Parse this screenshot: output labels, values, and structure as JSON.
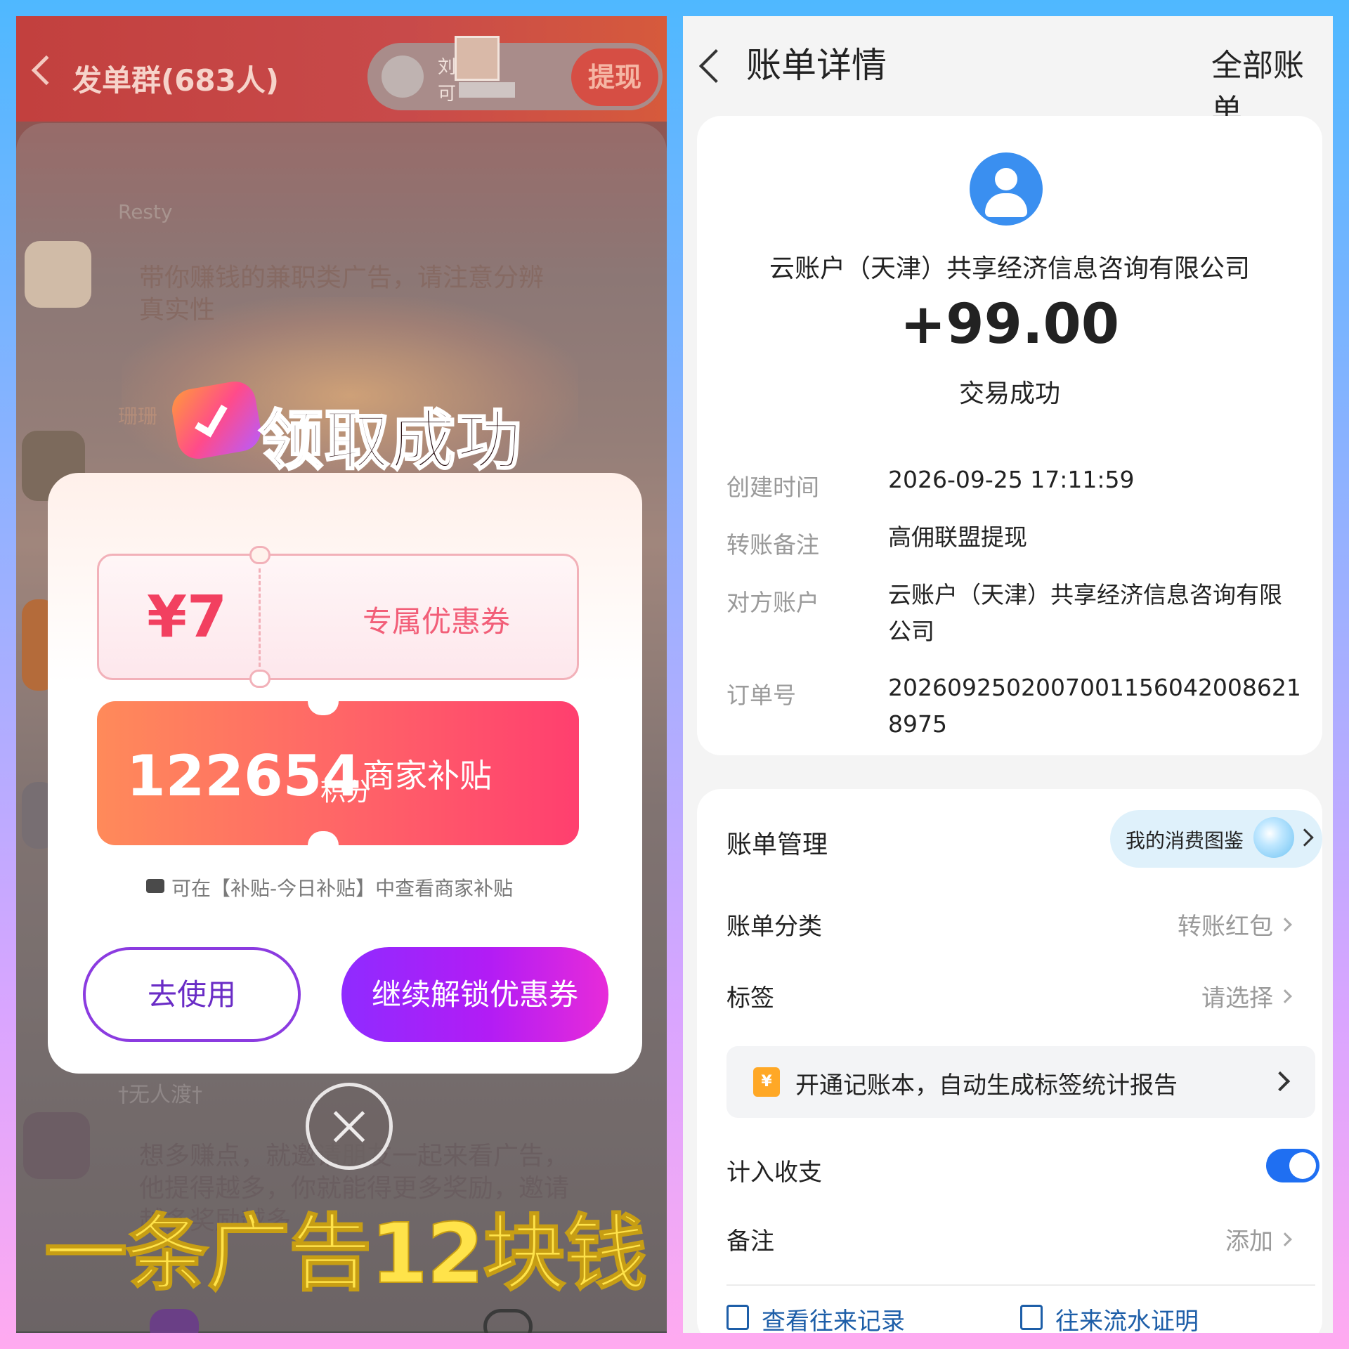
{
  "left": {
    "header": {
      "title": "发单群(683人)",
      "user_name_line1": "刘",
      "user_name_line2": "可",
      "withdraw_label": "提现"
    },
    "chat": {
      "message1_sender": "Resty",
      "message1_text": "带你赚钱的兼职类广告，请注意分辨真实性",
      "message2_sender": "珊珊",
      "message3_sender": "†无人渡†",
      "message3_text": "想多赚点，就邀请朋友一起来看广告，他提得越多，你就能得更多奖励，邀请越多奖励越多"
    },
    "modal": {
      "title": "领取成功",
      "coupon_amount": "¥7",
      "coupon_label": "专属优惠券",
      "points_value": "122654",
      "points_unit": "积分",
      "points_label": "商家补贴",
      "hint": "可在【补贴-今日补贴】中查看商家补贴",
      "use_button": "去使用",
      "unlock_button": "继续解锁优惠券"
    },
    "overlay_caption": "一条广告12块钱",
    "icons": {
      "back": "chevron-left-icon",
      "close": "close-icon",
      "check": "check-badge-icon",
      "ticket": "ticket-icon"
    },
    "colors": {
      "coupon_red": "#f24060",
      "unlock_purple": "#8f2bff",
      "caption_yellow": "#ffe34a"
    }
  },
  "right": {
    "header": {
      "title": "账单详情",
      "all_bills": "全部账单"
    },
    "summary": {
      "company": "云账户（天津）共享经济信息咨询有限公司",
      "amount": "+99.00",
      "status": "交易成功"
    },
    "details": [
      {
        "label": "创建时间",
        "value": "2026-09-25 17:11:59"
      },
      {
        "label": "转账备注",
        "value": "高佣联盟提现"
      },
      {
        "label": "对方账户",
        "value": "云账户（天津）共享经济信息咨询有限公司"
      },
      {
        "label": "订单号",
        "value": "20260925020070011560420086218975"
      }
    ],
    "management": {
      "title": "账单管理",
      "spend_guide": "我的消费图鉴",
      "category_label": "账单分类",
      "category_value": "转账红包",
      "tag_label": "标签",
      "tag_value": "请选择",
      "promo_icon": "¥",
      "promo_text": "开通记账本，自动生成标签统计报告",
      "income_label": "计入收支",
      "income_enabled": true,
      "note_label": "备注",
      "note_value": "添加",
      "link_history": "查看往来记录",
      "link_certificate": "往来流水证明"
    },
    "colors": {
      "accent_blue": "#1f6ff2",
      "avatar_blue": "#3a8ff0",
      "link_blue": "#1d5ea8"
    }
  }
}
